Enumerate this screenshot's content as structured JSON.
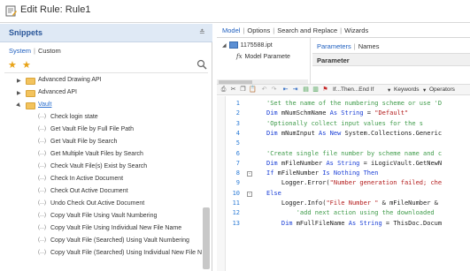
{
  "window": {
    "title": "Edit Rule: Rule1"
  },
  "snippets": {
    "title": "Snippets",
    "tabs": [
      "System",
      "Custom"
    ],
    "folders": [
      {
        "label": "Advanced Drawing API",
        "expanded": false
      },
      {
        "label": "Advanced API",
        "expanded": false
      },
      {
        "label": "Vault",
        "expanded": true
      }
    ],
    "vault_items": [
      "Check login state",
      "Get Vault File by Full File Path",
      "Get Vault File by Search",
      "Get Multiple Vault Files by Search",
      "Check Vault File(s) Exist by Search",
      "Check In Active Document",
      "Check Out Active Document",
      "Undo Check Out Active Document",
      "Copy Vault File Using Vault Numbering",
      "Copy Vault File Using Individual New File Name",
      "Copy Vault File (Searched) Using Vault Numbering",
      "Copy Vault File (Searched) Using Individual New File N"
    ],
    "snippet_marker": "(...)"
  },
  "right": {
    "tabs": [
      "Model",
      "Options",
      "Search and Replace",
      "Wizards"
    ],
    "model_tree": {
      "file": "1175588.ipt",
      "param": "Model Paramete"
    },
    "param_tabs": [
      "Parameters",
      "Names"
    ],
    "param_column": "Parameter"
  },
  "toolbar": {
    "if_label": "If...Then...End If",
    "keywords_label": "Keywords",
    "operators_label": "Operators"
  },
  "code": [
    {
      "n": "1",
      "parts": [
        {
          "c": "comment",
          "t": "'Set the name of the numbering scheme or use 'D"
        }
      ]
    },
    {
      "n": "2",
      "parts": [
        {
          "c": "kw",
          "t": "Dim "
        },
        {
          "c": "plain",
          "t": "mNumSchmName "
        },
        {
          "c": "kw",
          "t": "As String"
        },
        {
          "c": "plain",
          "t": " = "
        },
        {
          "c": "str",
          "t": "\"Default\""
        }
      ]
    },
    {
      "n": "3",
      "parts": [
        {
          "c": "comment",
          "t": "'Optionally collect input values for the s"
        }
      ]
    },
    {
      "n": "4",
      "parts": [
        {
          "c": "kw",
          "t": "Dim "
        },
        {
          "c": "plain",
          "t": "mNumInput "
        },
        {
          "c": "kw",
          "t": "As New "
        },
        {
          "c": "plain",
          "t": "System.Collections.Generic"
        }
      ]
    },
    {
      "n": "5",
      "parts": []
    },
    {
      "n": "6",
      "parts": [
        {
          "c": "comment",
          "t": "'Create single file number by scheme name and c"
        }
      ]
    },
    {
      "n": "7",
      "parts": [
        {
          "c": "kw",
          "t": "Dim "
        },
        {
          "c": "plain",
          "t": "mFileNumber "
        },
        {
          "c": "kw",
          "t": "As String"
        },
        {
          "c": "plain",
          "t": " = iLogicVault.GetNewN"
        }
      ]
    },
    {
      "n": "8",
      "parts": [
        {
          "c": "kw",
          "t": "If "
        },
        {
          "c": "plain",
          "t": "mFileNumber "
        },
        {
          "c": "kw",
          "t": "Is Nothing Then"
        }
      ]
    },
    {
      "n": "9",
      "parts": [
        {
          "c": "plain",
          "t": "    Logger.Error("
        },
        {
          "c": "str",
          "t": "\"Number generation failed; che"
        }
      ]
    },
    {
      "n": "10",
      "parts": [
        {
          "c": "kw",
          "t": "Else"
        }
      ]
    },
    {
      "n": "11",
      "parts": [
        {
          "c": "plain",
          "t": "    Logger.Info("
        },
        {
          "c": "str",
          "t": "\"File Number \""
        },
        {
          "c": "plain",
          "t": " & mFileNumber &"
        }
      ]
    },
    {
      "n": "12",
      "parts": [
        {
          "c": "comment",
          "t": "        'add next action using the downloaded"
        }
      ]
    },
    {
      "n": "13",
      "parts": [
        {
          "c": "plain",
          "t": "    "
        },
        {
          "c": "kw",
          "t": "Dim "
        },
        {
          "c": "plain",
          "t": "mFullFileName "
        },
        {
          "c": "kw",
          "t": "As String"
        },
        {
          "c": "plain",
          "t": " = ThisDoc.Docum"
        }
      ]
    }
  ],
  "colors": {
    "accent": "#1f5fbf",
    "comment": "#3f9b4a",
    "keyword": "#1a3fd6",
    "string": "#b31b1b",
    "folder": "#f3c35d"
  }
}
